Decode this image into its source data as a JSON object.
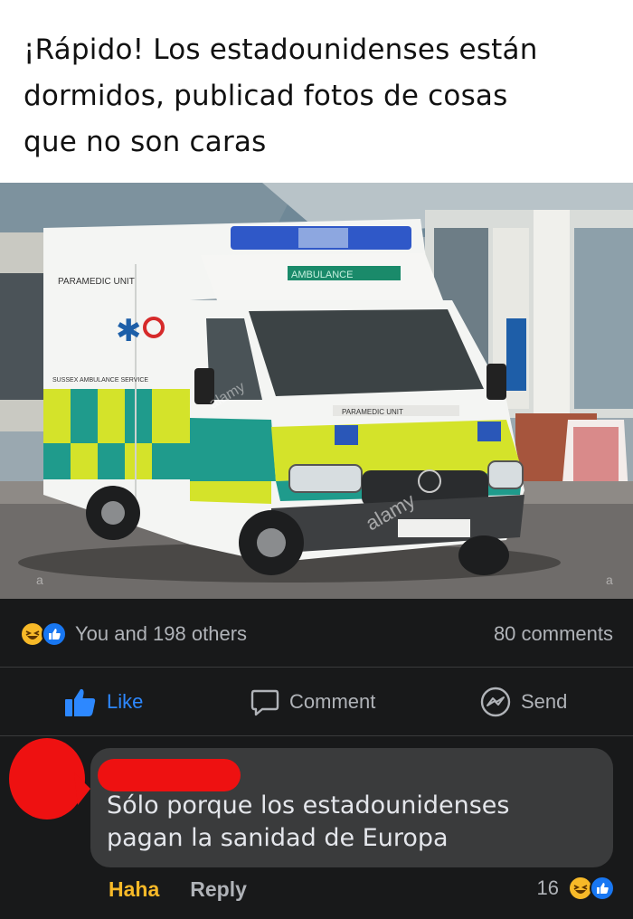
{
  "caption": {
    "text": "¡Rápido! Los estadounidenses están\ndormidos, publicad fotos de cosas\nque no son caras"
  },
  "photo": {
    "vehicle_label": "AMBULANCE",
    "side_label": "PARAMEDIC UNIT",
    "side_sub_label": "SUSSEX AMBULANCE SERVICE",
    "hood_label": "PARAMEDIC UNIT",
    "watermark": "alamy",
    "watermark_letter": "a"
  },
  "reactions": {
    "icons": [
      "haha-icon",
      "like-icon"
    ],
    "summary": "You and 198 others",
    "comments": "80 comments"
  },
  "actions": {
    "like": "Like",
    "comment": "Comment",
    "send": "Send"
  },
  "comment": {
    "text": "Sólo porque los estadounidenses\npagan la sanidad de Europa",
    "haha_label": "Haha",
    "reply_label": "Reply",
    "reaction_count": "16",
    "reaction_icons": [
      "haha-icon",
      "like-icon"
    ]
  },
  "colors": {
    "background": "#18191a",
    "bubble": "#3a3b3c",
    "like_blue": "#2d88ff",
    "haha_yellow": "#f7b928",
    "redaction_red": "#ee1111"
  }
}
